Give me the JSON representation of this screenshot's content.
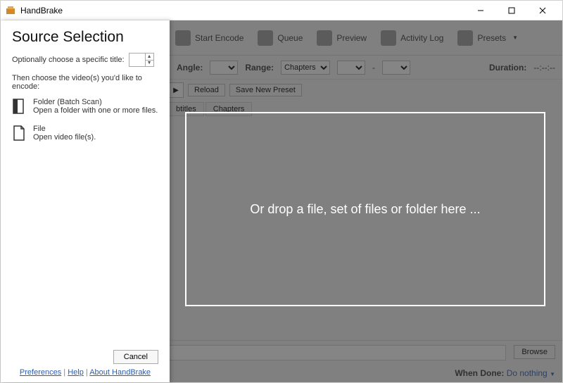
{
  "window": {
    "title": "HandBrake"
  },
  "toolbar": {
    "start_encode": "Start Encode",
    "queue": "Queue",
    "preview": "Preview",
    "activity_log": "Activity Log",
    "presets": "Presets"
  },
  "form": {
    "angle_label": "Angle:",
    "range_label": "Range:",
    "range_value": "Chapters",
    "range_sep": "-",
    "duration_label": "Duration:",
    "duration_value": "--:--:--",
    "reload": "Reload",
    "save_preset": "Save New Preset"
  },
  "tabs": {
    "subtitles": "btitles",
    "chapters": "Chapters"
  },
  "bottom": {
    "browse": "Browse",
    "when_done_label": "When Done:",
    "when_done_value": "Do nothing"
  },
  "dropzone": {
    "text": "Or drop a file, set of files or folder here ..."
  },
  "panel": {
    "heading": "Source Selection",
    "opt_title_label": "Optionally choose a specific title:",
    "instruction": "Then choose the video(s) you'd like to encode:",
    "folder": {
      "title": "Folder (Batch Scan)",
      "desc": "Open a folder with one or more files."
    },
    "file": {
      "title": "File",
      "desc": "Open video file(s)."
    },
    "cancel": "Cancel",
    "links": {
      "preferences": "Preferences",
      "help": "Help",
      "about": "About HandBrake",
      "sep": " | "
    }
  }
}
